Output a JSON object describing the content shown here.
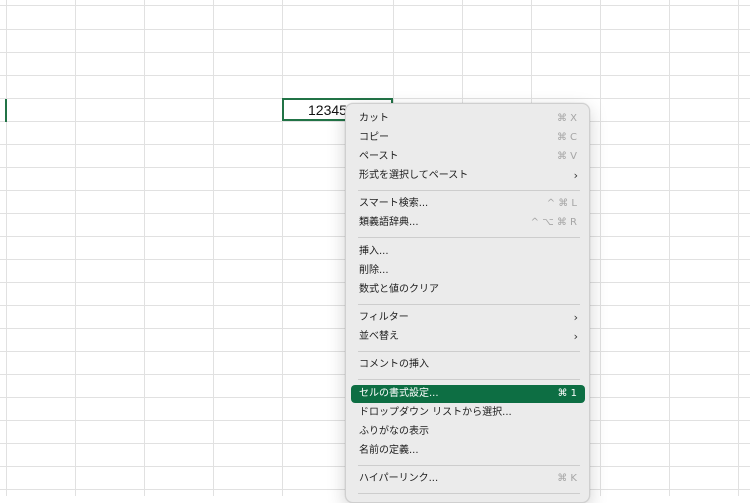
{
  "cell": {
    "value": "12345"
  },
  "menu": {
    "items": [
      {
        "label": "カット",
        "shortcut": "⌘ X"
      },
      {
        "label": "コピー",
        "shortcut": "⌘ C"
      },
      {
        "label": "ペースト",
        "shortcut": "⌘ V"
      },
      {
        "label": "形式を選択してペースト",
        "submenu": "›"
      },
      {
        "label": "スマート検索...",
        "shortcut": "^ ⌘ L"
      },
      {
        "label": "類義語辞典...",
        "shortcut": "^ ⌥ ⌘ R"
      },
      {
        "label": "挿入..."
      },
      {
        "label": "削除..."
      },
      {
        "label": "数式と値のクリア"
      },
      {
        "label": "フィルター",
        "submenu": "›"
      },
      {
        "label": "並べ替え",
        "submenu": "›"
      },
      {
        "label": "コメントの挿入"
      },
      {
        "label": "セルの書式設定...",
        "shortcut": "⌘ 1",
        "highlighted": true
      },
      {
        "label": "ドロップダウン リストから選択..."
      },
      {
        "label": "ふりがなの表示"
      },
      {
        "label": "名前の定義..."
      },
      {
        "label": "ハイパーリンク...",
        "shortcut": "⌘ K"
      }
    ]
  },
  "colors": {
    "accent": "#0d6e43",
    "cell_border": "#217346",
    "gridline": "#e1e1e1"
  }
}
